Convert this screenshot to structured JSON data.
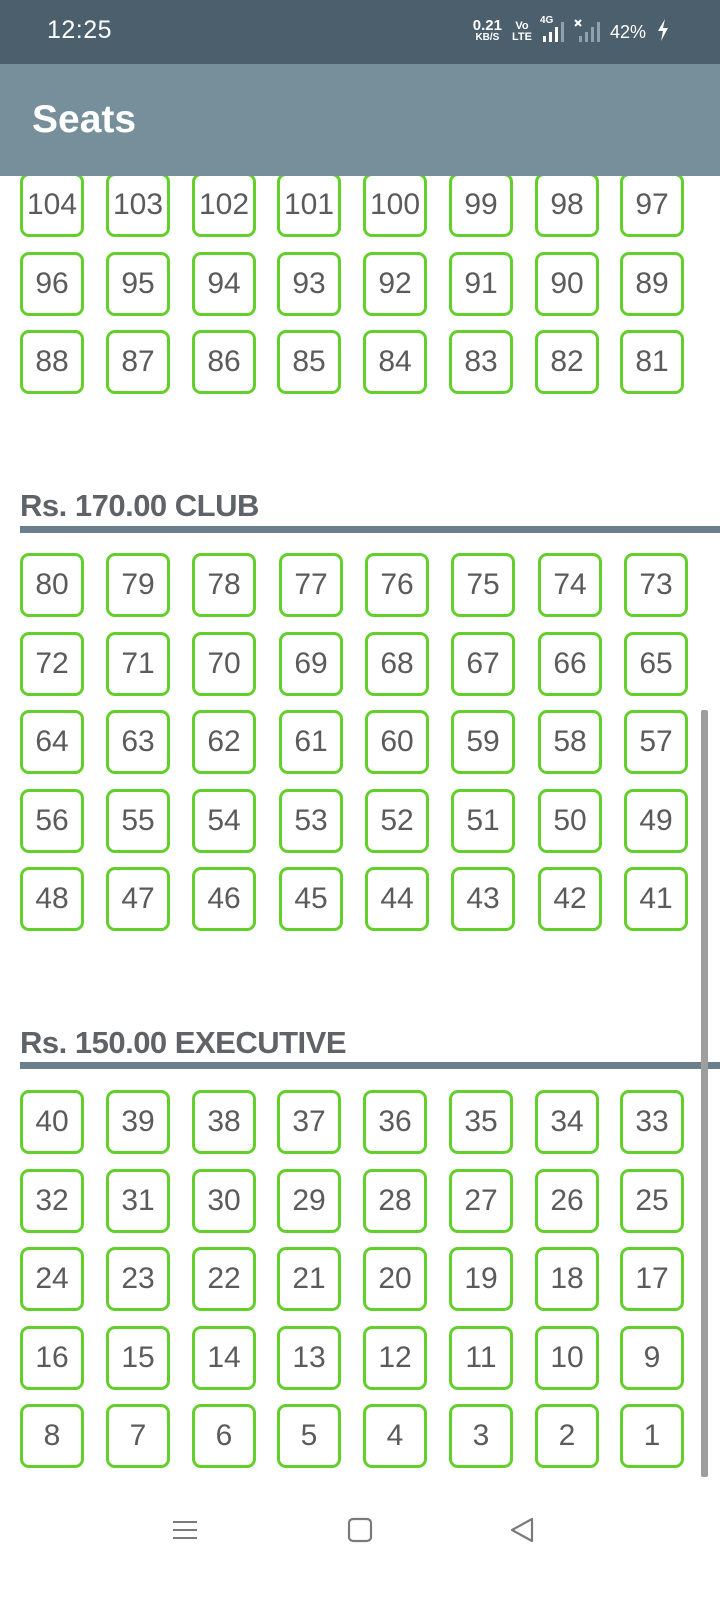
{
  "status_bar": {
    "time": "12:25",
    "net_speed_value": "0.21",
    "net_speed_unit": "KB/S",
    "volte_top": "Vo",
    "volte_bottom": "LTE",
    "network_type": "4G",
    "battery": "42%",
    "icons": [
      "signal-4g-icon",
      "signal-no-sim-icon",
      "charging-bolt-icon"
    ]
  },
  "app_bar": {
    "title": "Seats"
  },
  "colors": {
    "status_bar": "#4b5f6c",
    "app_bar": "#778f9b",
    "seat_border": "#62cf2b",
    "seat_text": "#5b5b5b",
    "section_line": "#6a7f8b"
  },
  "sections": [
    {
      "title": "",
      "rows": [
        [
          "104",
          "103",
          "102",
          "101",
          "100",
          "99",
          "98",
          "97"
        ],
        [
          "96",
          "95",
          "94",
          "93",
          "92",
          "91",
          "90",
          "89"
        ],
        [
          "88",
          "87",
          "86",
          "85",
          "84",
          "83",
          "82",
          "81"
        ]
      ]
    },
    {
      "title": "Rs. 170.00 CLUB",
      "rows": [
        [
          "80",
          "79",
          "78",
          "77",
          "76",
          "75",
          "74",
          "73"
        ],
        [
          "72",
          "71",
          "70",
          "69",
          "68",
          "67",
          "66",
          "65"
        ],
        [
          "64",
          "63",
          "62",
          "61",
          "60",
          "59",
          "58",
          "57"
        ],
        [
          "56",
          "55",
          "54",
          "53",
          "52",
          "51",
          "50",
          "49"
        ],
        [
          "48",
          "47",
          "46",
          "45",
          "44",
          "43",
          "42",
          "41"
        ]
      ]
    },
    {
      "title": "Rs. 150.00 EXECUTIVE",
      "rows": [
        [
          "40",
          "39",
          "38",
          "37",
          "36",
          "35",
          "34",
          "33"
        ],
        [
          "32",
          "31",
          "30",
          "29",
          "28",
          "27",
          "26",
          "25"
        ],
        [
          "24",
          "23",
          "22",
          "21",
          "20",
          "19",
          "18",
          "17"
        ],
        [
          "16",
          "15",
          "14",
          "13",
          "12",
          "11",
          "10",
          "9"
        ],
        [
          "8",
          "7",
          "6",
          "5",
          "4",
          "3",
          "2",
          "1"
        ]
      ]
    }
  ],
  "nav_bar": {
    "icons": [
      "menu-icon",
      "home-icon",
      "back-icon"
    ]
  }
}
